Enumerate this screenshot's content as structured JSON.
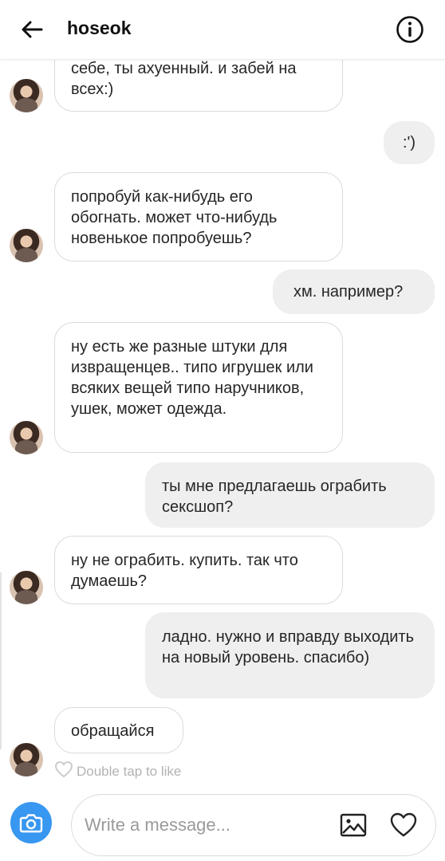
{
  "header": {
    "title": "hoseok",
    "back_icon": "arrow-left-icon",
    "info_icon": "info-icon"
  },
  "messages": [
    {
      "side": "in",
      "text": "себе, ты ахуенный. и забей на всех:)"
    },
    {
      "side": "out",
      "text": ":')"
    },
    {
      "side": "in",
      "text": "попробуй как-нибудь его обогнать. может что-нибудь новенькое попробуешь?"
    },
    {
      "side": "out",
      "text": "хм. например?"
    },
    {
      "side": "in",
      "text": "ну есть же разные штуки для извращенцев.. типо игрушек или всяких вещей типо наручников, ушек, может одежда."
    },
    {
      "side": "out",
      "text": "ты мне предлагаешь ограбить сексшоп?"
    },
    {
      "side": "in",
      "text": "ну не ограбить. купить. так что думаешь?"
    },
    {
      "side": "out",
      "text": "ладно. нужно и вправду выходить на новый уровень. спасибо)"
    },
    {
      "side": "in",
      "text": "обращайся"
    }
  ],
  "like_hint": "Double tap to like",
  "composer": {
    "placeholder": "Write a message...",
    "camera_icon": "camera-icon",
    "gallery_icon": "image-icon",
    "heart_icon": "heart-icon"
  },
  "colors": {
    "accent": "#3897f0",
    "incoming_border": "#dbdbdb",
    "outgoing_bg": "#efefef"
  }
}
